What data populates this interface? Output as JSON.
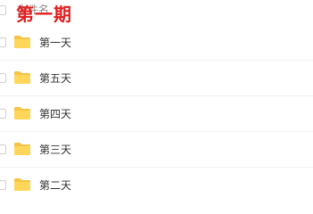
{
  "header": {
    "column_label": "文件名",
    "overlay_title": "第一期"
  },
  "files": [
    {
      "name": "第一天",
      "icon": "folder-icon"
    },
    {
      "name": "第五天",
      "icon": "folder-icon"
    },
    {
      "name": "第四天",
      "icon": "folder-icon"
    },
    {
      "name": "第三天",
      "icon": "folder-icon"
    },
    {
      "name": "第二天",
      "icon": "folder-icon"
    }
  ],
  "colors": {
    "folder": "#FFD659",
    "folder_tab": "#F5C445",
    "title_red": "#E01F1F"
  }
}
